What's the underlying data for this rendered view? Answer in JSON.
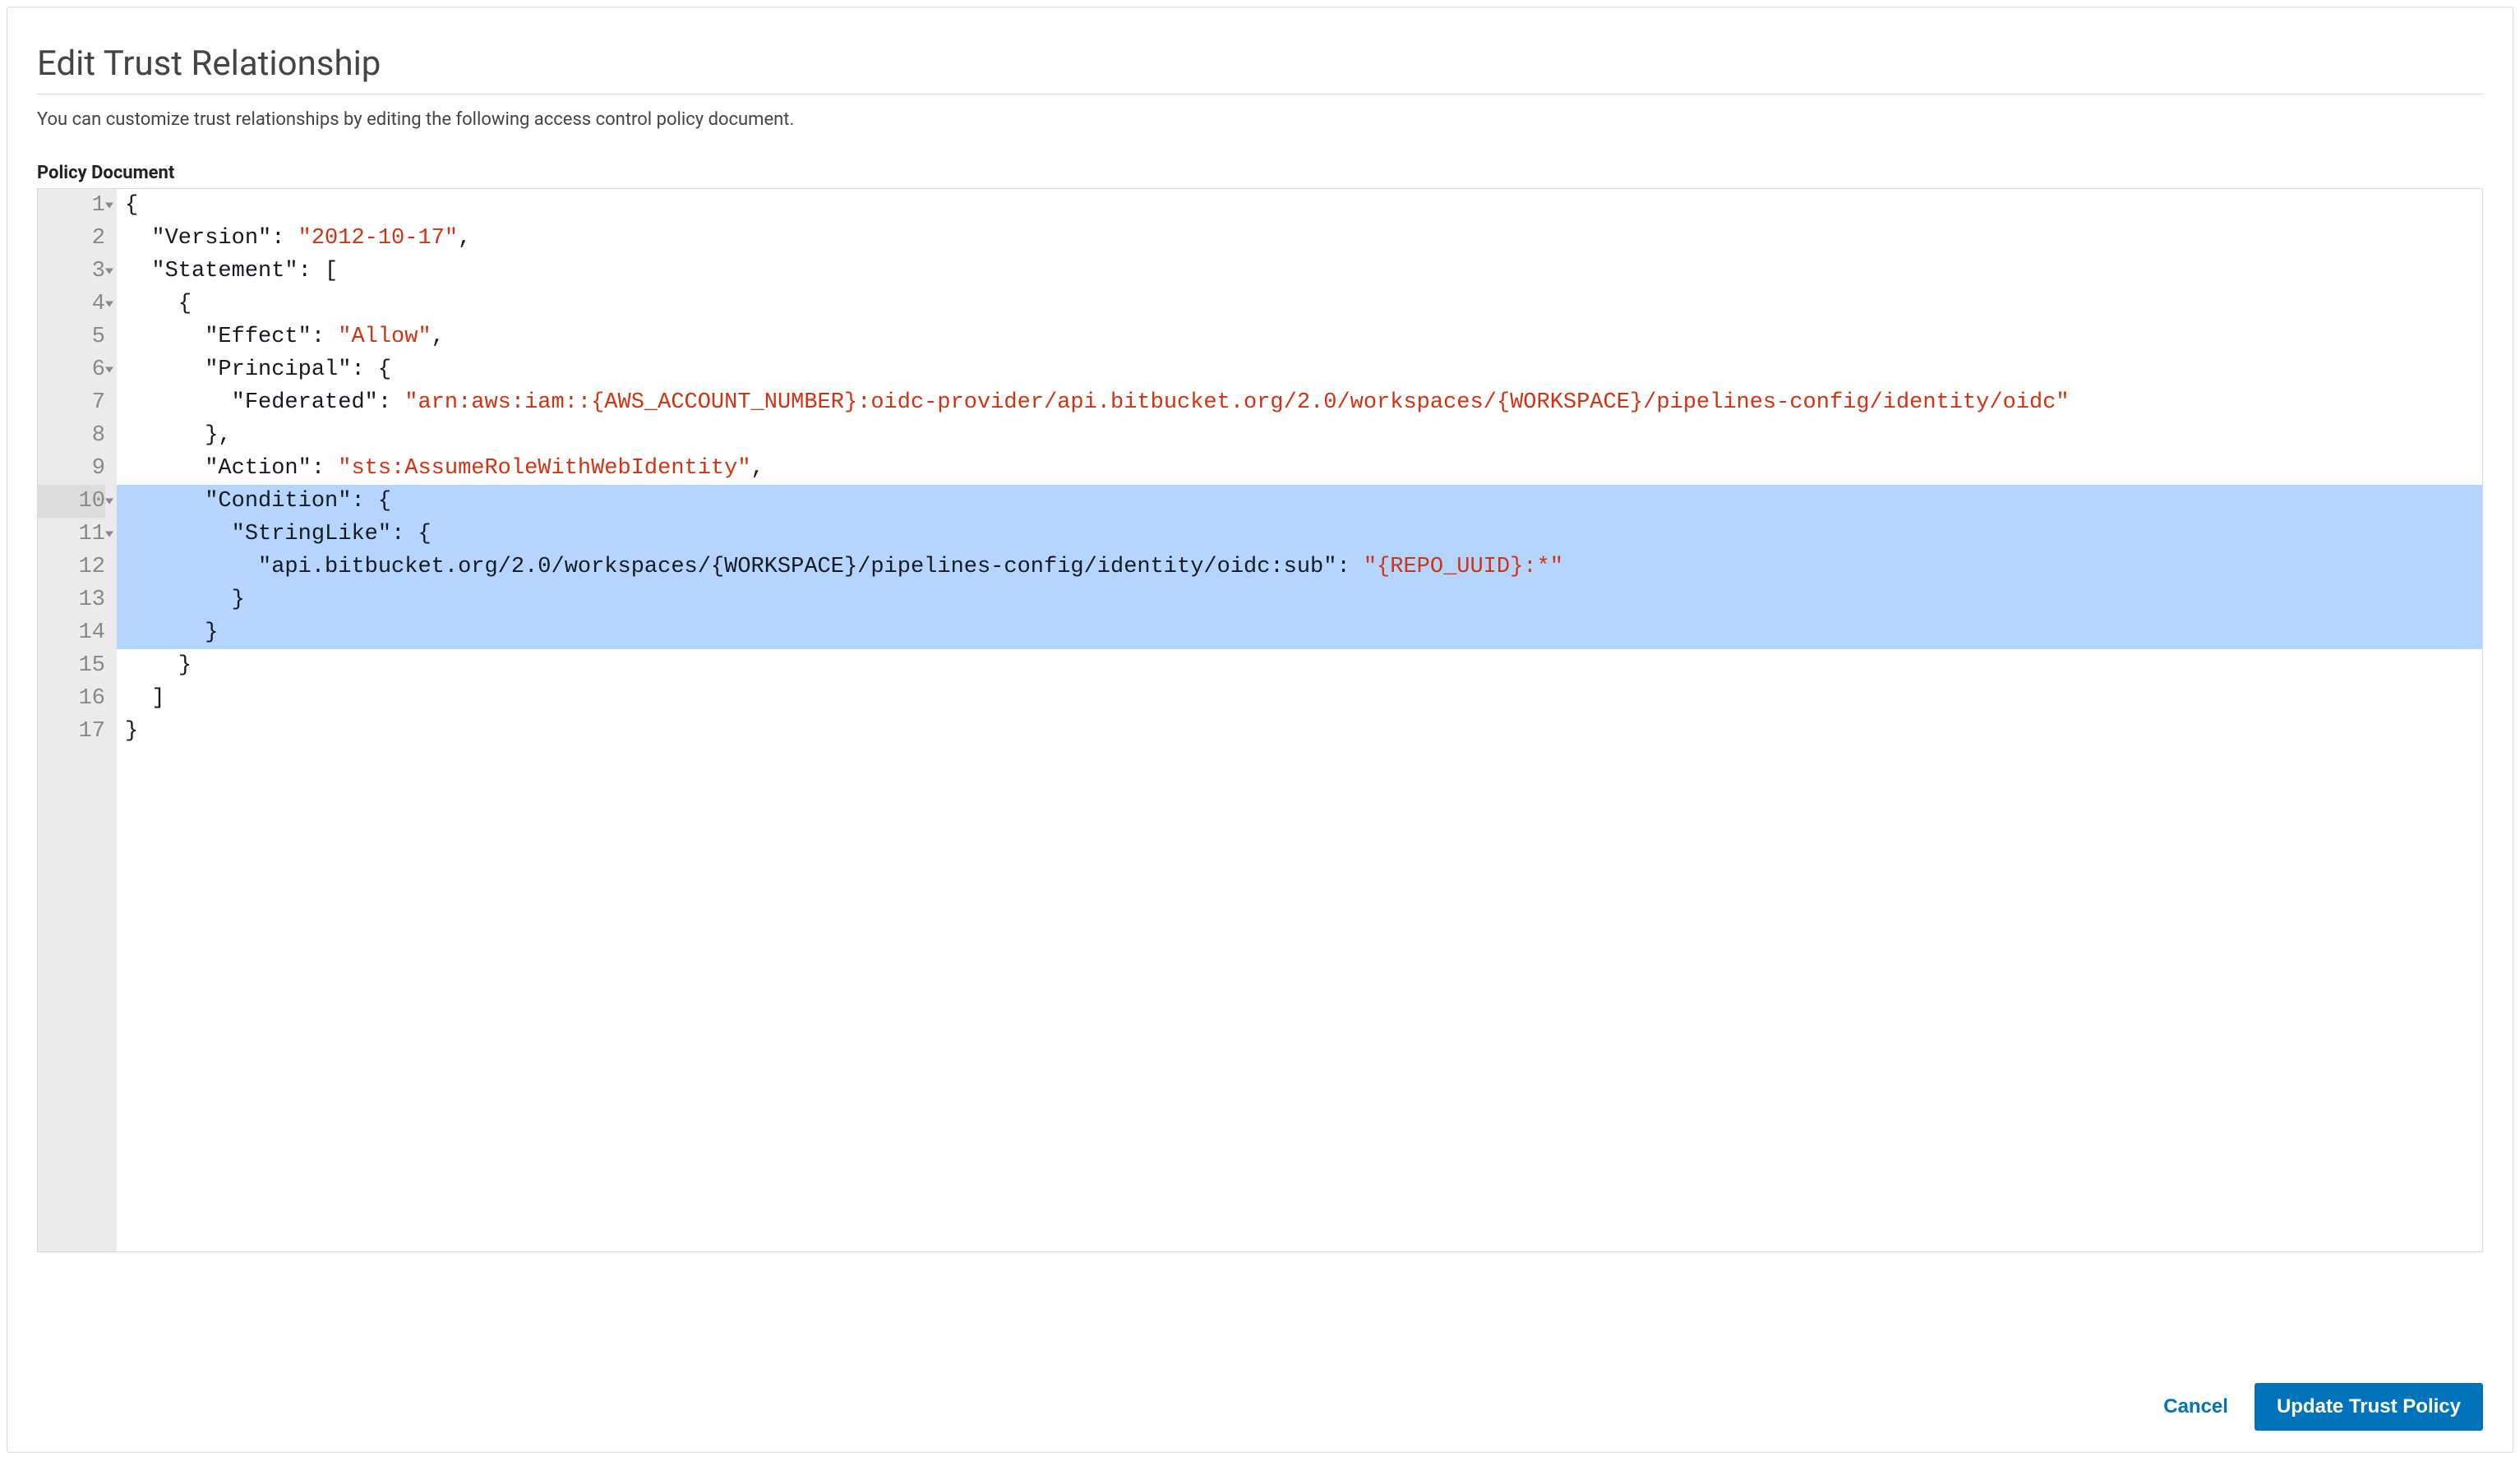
{
  "header": {
    "title": "Edit Trust Relationship",
    "description": "You can customize trust relationships by editing the following access control policy document.",
    "section_label": "Policy Document"
  },
  "editor": {
    "active_line": 10,
    "highlighted_lines": [
      10,
      11,
      12,
      13,
      14
    ],
    "lines": [
      {
        "n": 1,
        "fold": true,
        "tokens": [
          [
            "punc",
            "{"
          ]
        ]
      },
      {
        "n": 2,
        "fold": false,
        "tokens": [
          [
            "indent",
            "  "
          ],
          [
            "key",
            "\"Version\""
          ],
          [
            "punc",
            ": "
          ],
          [
            "str",
            "\"2012-10-17\""
          ],
          [
            "punc",
            ","
          ]
        ]
      },
      {
        "n": 3,
        "fold": true,
        "tokens": [
          [
            "indent",
            "  "
          ],
          [
            "key",
            "\"Statement\""
          ],
          [
            "punc",
            ": ["
          ]
        ]
      },
      {
        "n": 4,
        "fold": true,
        "tokens": [
          [
            "indent",
            "    "
          ],
          [
            "punc",
            "{"
          ]
        ]
      },
      {
        "n": 5,
        "fold": false,
        "tokens": [
          [
            "indent",
            "      "
          ],
          [
            "key",
            "\"Effect\""
          ],
          [
            "punc",
            ": "
          ],
          [
            "str",
            "\"Allow\""
          ],
          [
            "punc",
            ","
          ]
        ]
      },
      {
        "n": 6,
        "fold": true,
        "tokens": [
          [
            "indent",
            "      "
          ],
          [
            "key",
            "\"Principal\""
          ],
          [
            "punc",
            ": {"
          ]
        ]
      },
      {
        "n": 7,
        "fold": false,
        "tokens": [
          [
            "indent",
            "        "
          ],
          [
            "key",
            "\"Federated\""
          ],
          [
            "punc",
            ": "
          ],
          [
            "str",
            "\"arn:aws:iam::{AWS_ACCOUNT_NUMBER}:oidc-provider/api.bitbucket.org/2.0/workspaces/{WORKSPACE}/pipelines-config/identity/oidc\""
          ]
        ]
      },
      {
        "n": 8,
        "fold": false,
        "tokens": [
          [
            "indent",
            "      "
          ],
          [
            "punc",
            "},"
          ]
        ]
      },
      {
        "n": 9,
        "fold": false,
        "tokens": [
          [
            "indent",
            "      "
          ],
          [
            "key",
            "\"Action\""
          ],
          [
            "punc",
            ": "
          ],
          [
            "str",
            "\"sts:AssumeRoleWithWebIdentity\""
          ],
          [
            "punc",
            ","
          ]
        ]
      },
      {
        "n": 10,
        "fold": true,
        "tokens": [
          [
            "indent",
            "      "
          ],
          [
            "key",
            "\"Condition\""
          ],
          [
            "punc",
            ": {"
          ]
        ]
      },
      {
        "n": 11,
        "fold": true,
        "tokens": [
          [
            "indent",
            "        "
          ],
          [
            "key",
            "\"StringLike\""
          ],
          [
            "punc",
            ": {"
          ]
        ]
      },
      {
        "n": 12,
        "fold": false,
        "tokens": [
          [
            "indent",
            "          "
          ],
          [
            "key",
            "\"api.bitbucket.org/2.0/workspaces/{WORKSPACE}/pipelines-config/identity/oidc:sub\""
          ],
          [
            "punc",
            ": "
          ],
          [
            "str",
            "\"{REPO_UUID}:*\""
          ]
        ]
      },
      {
        "n": 13,
        "fold": false,
        "tokens": [
          [
            "indent",
            "        "
          ],
          [
            "punc",
            "}"
          ]
        ]
      },
      {
        "n": 14,
        "fold": false,
        "tokens": [
          [
            "indent",
            "      "
          ],
          [
            "punc",
            "}"
          ]
        ]
      },
      {
        "n": 15,
        "fold": false,
        "tokens": [
          [
            "indent",
            "    "
          ],
          [
            "punc",
            "}"
          ]
        ]
      },
      {
        "n": 16,
        "fold": false,
        "tokens": [
          [
            "indent",
            "  "
          ],
          [
            "punc",
            "]"
          ]
        ]
      },
      {
        "n": 17,
        "fold": false,
        "tokens": [
          [
            "punc",
            "}"
          ]
        ]
      }
    ]
  },
  "buttons": {
    "cancel": "Cancel",
    "submit": "Update Trust Policy"
  }
}
